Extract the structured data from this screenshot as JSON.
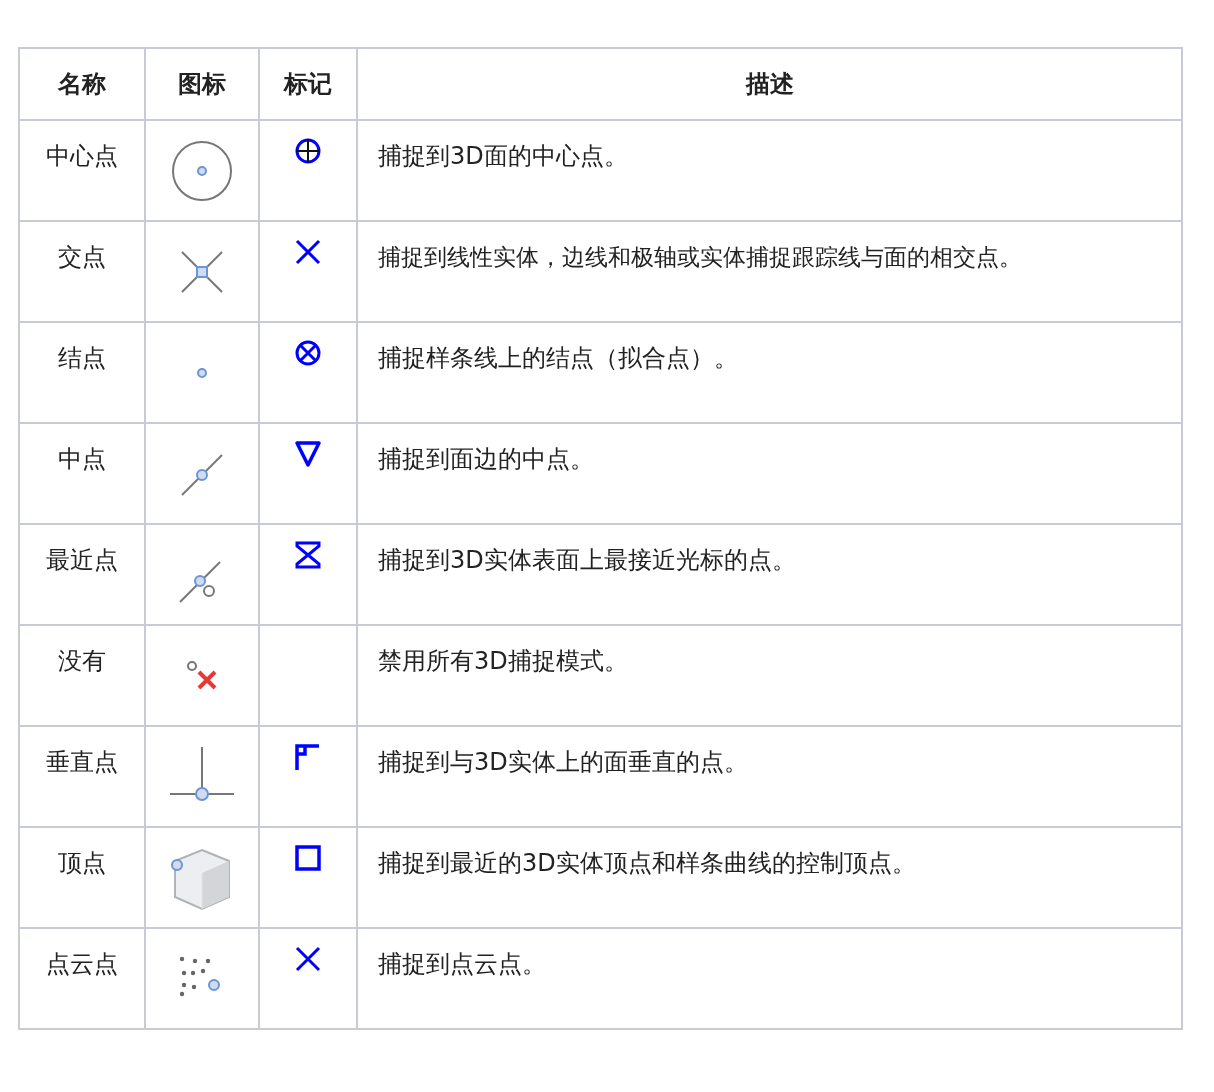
{
  "table": {
    "columns": [
      "名称",
      "图标",
      "标记",
      "描述"
    ],
    "rows": [
      {
        "name": "中心点",
        "description": "捕捉到3D面的中心点。"
      },
      {
        "name": "交点",
        "description": "捕捉到线性实体，边线和极轴或实体捕捉跟踪线与面的相交点。"
      },
      {
        "name": "结点",
        "description": "捕捉样条线上的结点（拟合点）。"
      },
      {
        "name": "中点",
        "description": "捕捉到面边的中点。"
      },
      {
        "name": "最近点",
        "description": "捕捉到3D实体表面上最接近光标的点。"
      },
      {
        "name": "没有",
        "description": "禁用所有3D捕捉模式。"
      },
      {
        "name": "垂直点",
        "description": "捕捉到与3D实体上的面垂直的点。"
      },
      {
        "name": "顶点",
        "description": "捕捉到最近的3D实体顶点和样条曲线的控制顶点。"
      },
      {
        "name": "点云点",
        "description": "捕捉到点云点。"
      }
    ]
  }
}
